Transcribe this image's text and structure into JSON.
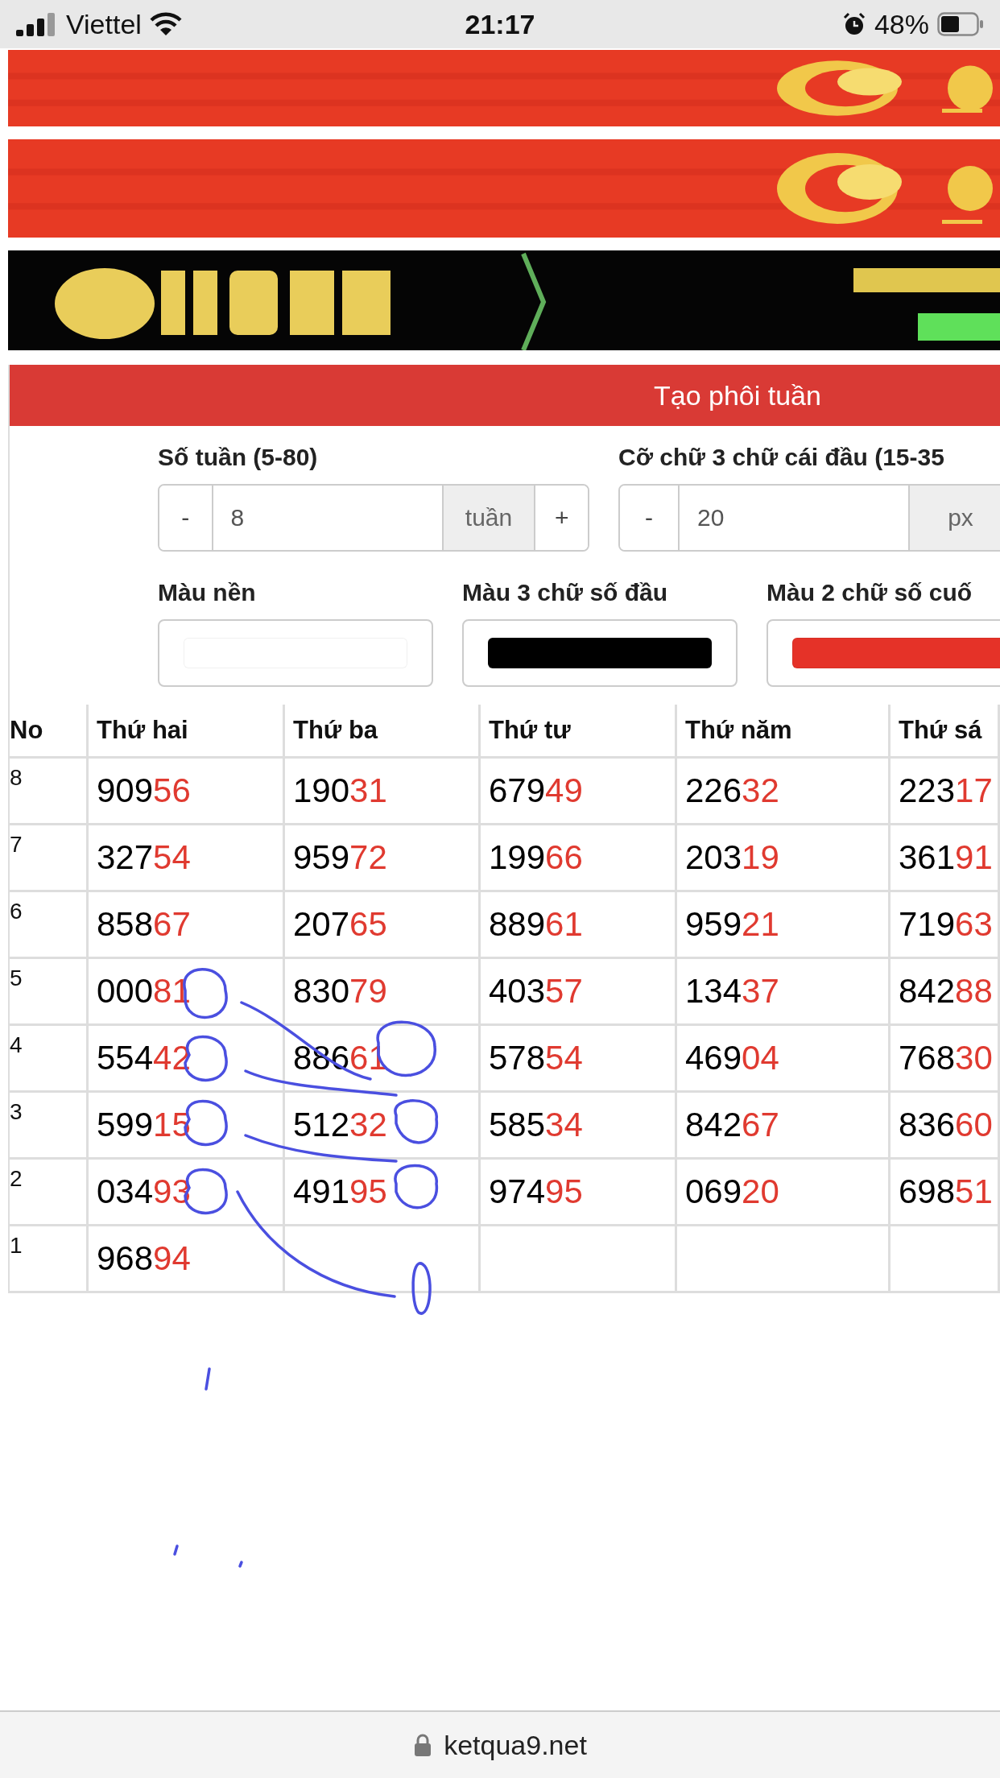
{
  "status_bar": {
    "carrier": "Viettel",
    "time": "21:17",
    "battery": "48%"
  },
  "panel": {
    "title": "Tạo phôi tuần",
    "steppers": [
      {
        "label": "Số tuần (5-80)",
        "minus": "-",
        "value": "8",
        "unit": "tuần",
        "plus": "+"
      },
      {
        "label": "Cỡ chữ 3 chữ cái đầu (15-35",
        "minus": "-",
        "value": "20",
        "unit": "px"
      }
    ],
    "color_fields": [
      {
        "label": "Màu nền",
        "color": "#ffffff"
      },
      {
        "label": "Màu 3 chữ số đầu",
        "color": "#000000"
      },
      {
        "label": "Màu 2 chữ số cuố",
        "color": "#e53228"
      }
    ]
  },
  "table": {
    "columns": [
      "No",
      "Thứ hai",
      "Thứ ba",
      "Thứ tư",
      "Thứ năm",
      "Thứ sá"
    ],
    "rows": [
      {
        "cells": [
          {
            "kind": "number",
            "text": "8"
          },
          {
            "head": "909",
            "tail": "56"
          },
          {
            "head": "190",
            "tail": "31"
          },
          {
            "head": "679",
            "tail": "49"
          },
          {
            "head": "226",
            "tail": "32"
          },
          {
            "head": "223",
            "tail": "17"
          }
        ]
      },
      {
        "cells": [
          {
            "kind": "number",
            "text": "7"
          },
          {
            "head": "327",
            "tail": "54"
          },
          {
            "head": "959",
            "tail": "72"
          },
          {
            "head": "199",
            "tail": "66"
          },
          {
            "head": "203",
            "tail": "19"
          },
          {
            "head": "361",
            "tail": "91"
          }
        ]
      },
      {
        "cells": [
          {
            "kind": "number",
            "text": "6"
          },
          {
            "head": "858",
            "tail": "67"
          },
          {
            "head": "207",
            "tail": "65"
          },
          {
            "head": "889",
            "tail": "61"
          },
          {
            "head": "959",
            "tail": "21"
          },
          {
            "head": "719",
            "tail": "63"
          }
        ]
      },
      {
        "cells": [
          {
            "kind": "number",
            "text": "5"
          },
          {
            "head": "000",
            "tail": "81"
          },
          {
            "head": "830",
            "tail": "79"
          },
          {
            "head": "403",
            "tail": "57"
          },
          {
            "head": "134",
            "tail": "37"
          },
          {
            "head": "842",
            "tail": "88"
          }
        ]
      },
      {
        "cells": [
          {
            "kind": "number",
            "text": "4"
          },
          {
            "head": "554",
            "tail": "42"
          },
          {
            "head": "886",
            "tail": "61"
          },
          {
            "head": "578",
            "tail": "54"
          },
          {
            "head": "469",
            "tail": "04"
          },
          {
            "head": "768",
            "tail": "30"
          }
        ]
      },
      {
        "cells": [
          {
            "kind": "number",
            "text": "3"
          },
          {
            "head": "599",
            "tail": "15"
          },
          {
            "head": "512",
            "tail": "32"
          },
          {
            "head": "585",
            "tail": "34"
          },
          {
            "head": "842",
            "tail": "67"
          },
          {
            "head": "836",
            "tail": "60"
          }
        ]
      },
      {
        "cells": [
          {
            "kind": "number",
            "text": "2"
          },
          {
            "head": "034",
            "tail": "93"
          },
          {
            "head": "491",
            "tail": "95"
          },
          {
            "head": "974",
            "tail": "95"
          },
          {
            "head": "069",
            "tail": "20"
          },
          {
            "head": "698",
            "tail": "51"
          }
        ]
      },
      {
        "cells": [
          {
            "kind": "number",
            "text": "1"
          },
          {
            "head": "968",
            "tail": "94"
          },
          "",
          "",
          "",
          ""
        ]
      }
    ]
  },
  "address_bar": {
    "url": "ketqua9.net"
  }
}
